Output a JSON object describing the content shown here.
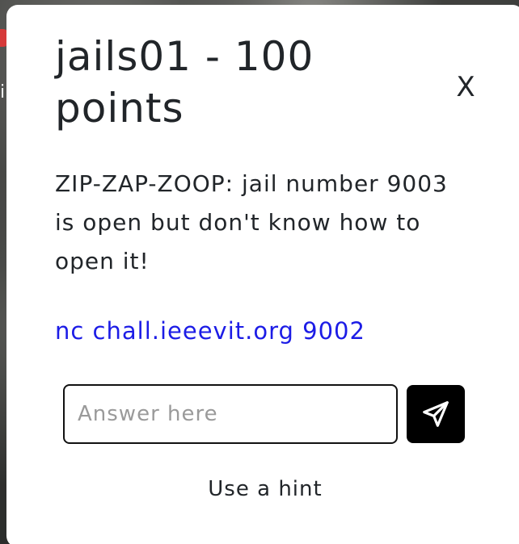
{
  "background": {
    "side_glyph": "i"
  },
  "modal": {
    "title": "jails01 - 100 points",
    "close_label": "X",
    "description": "ZIP-ZAP-ZOOP: jail number 9003 is open but don't know how to open it!",
    "connection_link": "nc chall.ieeevit.org 9002",
    "answer": {
      "placeholder": "Answer here",
      "value": ""
    },
    "submit_icon": "send-icon",
    "hint_label": "Use a hint"
  },
  "colors": {
    "link": "#1c1ce6",
    "submit_bg": "#000000",
    "modal_bg": "#ffffff",
    "accent_red": "#d63a3a"
  }
}
